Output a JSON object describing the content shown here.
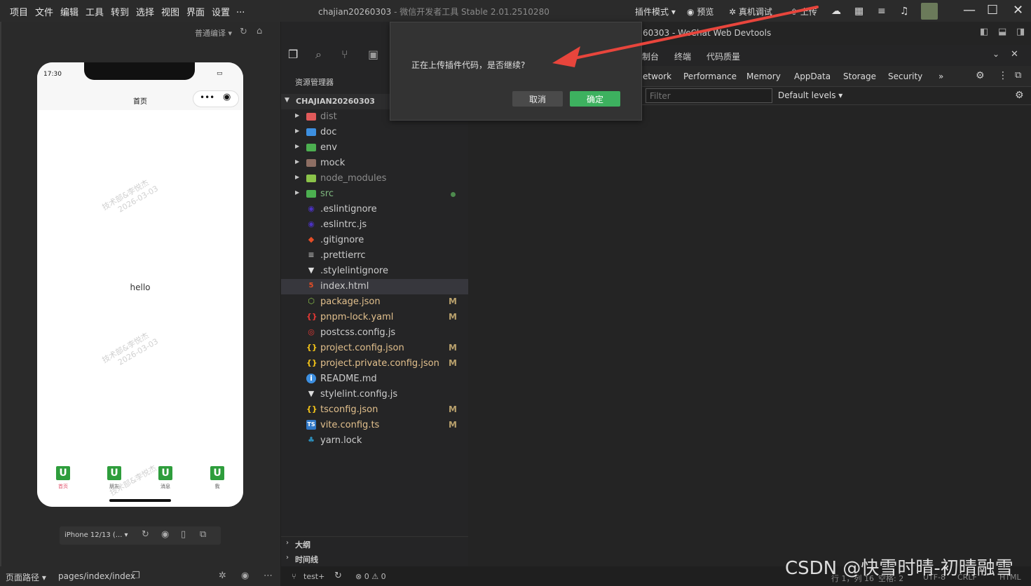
{
  "menu": [
    "项目",
    "文件",
    "编辑",
    "工具",
    "转到",
    "选择",
    "视图",
    "界面",
    "设置",
    "..."
  ],
  "app_title": {
    "project": "chajian20260303",
    "rest": " - 微信开发者工具 Stable 2.01.2510280"
  },
  "toolbar": {
    "plugin_mode": "插件模式 ▾",
    "preview": "预览",
    "real_debug": "真机调试",
    "upload": "上传"
  },
  "simulator": {
    "compile_mode": "普通编译 ▾",
    "time": "17:30",
    "nav_title": "首页",
    "hello": "hello",
    "watermark_line1": "技术部&李悦杰",
    "watermark_line2": "2026-03-03",
    "tabs": [
      "首页",
      "朋友",
      "消息",
      "我"
    ],
    "tab_icon": "U",
    "device": "iPhone 12/13 (... ▾",
    "page_path_label": "页面路径 ▾",
    "page_path": "pages/index/index"
  },
  "explorer": {
    "title": "资源管理器",
    "root": "CHAJIAN20260303",
    "items": [
      {
        "name": "dist",
        "type": "folder",
        "style": "dim",
        "icon": "folder-red-icon",
        "color": "#e05a5a"
      },
      {
        "name": "doc",
        "type": "folder",
        "style": "",
        "icon": "folder-blue-icon",
        "color": "#3d8fe0"
      },
      {
        "name": "env",
        "type": "folder",
        "style": "",
        "icon": "folder-green-icon",
        "color": "#4caf50"
      },
      {
        "name": "mock",
        "type": "folder",
        "style": "",
        "icon": "folder-brown-icon",
        "color": "#8d6e63"
      },
      {
        "name": "node_modules",
        "type": "folder",
        "style": "dim",
        "icon": "folder-node-icon",
        "color": "#8bc34a"
      },
      {
        "name": "src",
        "type": "folder",
        "style": "src",
        "icon": "folder-src-icon",
        "color": "#4caf50",
        "dot": true
      },
      {
        "name": ".eslintignore",
        "type": "file",
        "style": "",
        "icon": "eslint-icon",
        "color": "#4b32c3"
      },
      {
        "name": ".eslintrc.js",
        "type": "file",
        "style": "",
        "icon": "eslint-icon",
        "color": "#4b32c3"
      },
      {
        "name": ".gitignore",
        "type": "file",
        "style": "",
        "icon": "git-icon",
        "color": "#e44d26"
      },
      {
        "name": ".prettierrc",
        "type": "file",
        "style": "",
        "icon": "prettier-icon",
        "color": "#b0b0b0"
      },
      {
        "name": ".stylelintignore",
        "type": "file",
        "style": "",
        "icon": "stylelint-icon",
        "color": "#dddddd"
      },
      {
        "name": "index.html",
        "type": "file",
        "style": "",
        "icon": "html-icon",
        "color": "#e44d26",
        "selected": true
      },
      {
        "name": "package.json",
        "type": "file",
        "style": "mod",
        "icon": "nodejs-icon",
        "color": "#8bc34a",
        "badge": "M"
      },
      {
        "name": "pnpm-lock.yaml",
        "type": "file",
        "style": "mod",
        "icon": "yaml-icon",
        "color": "#e53935",
        "badge": "M"
      },
      {
        "name": "postcss.config.js",
        "type": "file",
        "style": "",
        "icon": "postcss-icon",
        "color": "#e53935"
      },
      {
        "name": "project.config.json",
        "type": "file",
        "style": "mod",
        "icon": "json-icon",
        "color": "#f5c518",
        "badge": "M"
      },
      {
        "name": "project.private.config.json",
        "type": "file",
        "style": "mod",
        "icon": "json-icon",
        "color": "#f5c518",
        "badge": "M"
      },
      {
        "name": "README.md",
        "type": "file",
        "style": "",
        "icon": "info-icon",
        "color": "#3d8fe0"
      },
      {
        "name": "stylelint.config.js",
        "type": "file",
        "style": "",
        "icon": "stylelint-icon",
        "color": "#dddddd"
      },
      {
        "name": "tsconfig.json",
        "type": "file",
        "style": "mod",
        "icon": "json-icon",
        "color": "#f5c518",
        "badge": "M"
      },
      {
        "name": "vite.config.ts",
        "type": "file",
        "style": "mod",
        "icon": "ts-icon",
        "color": "#3178c6",
        "badge": "M"
      },
      {
        "name": "yarn.lock",
        "type": "file",
        "style": "",
        "icon": "yarn-icon",
        "color": "#2c8ebb"
      }
    ],
    "outline": "大纲",
    "timeline": "时间线"
  },
  "devtools": {
    "title": "60303 - WeChat Web Devtools",
    "top_tabs": [
      "制台",
      "终端",
      "代码质量"
    ],
    "tabs": [
      "etwork",
      "Performance",
      "Memory",
      "AppData",
      "Storage",
      "Security",
      "»"
    ],
    "filter_placeholder": "Filter",
    "levels": "Default levels ▾"
  },
  "dialog": {
    "message": "正在上传插件代码，是否继续?",
    "cancel": "取消",
    "ok": "确定"
  },
  "statusbar": {
    "branch": "test+",
    "problems": "⊗ 0 ⚠ 0",
    "position": "行 1，列 16",
    "spaces": "空格: 2",
    "encoding": "UTF-8",
    "eol": "CRLF",
    "lang": "HTML"
  },
  "csdn_watermark": "CSDN @快雪时晴-初晴融雪"
}
